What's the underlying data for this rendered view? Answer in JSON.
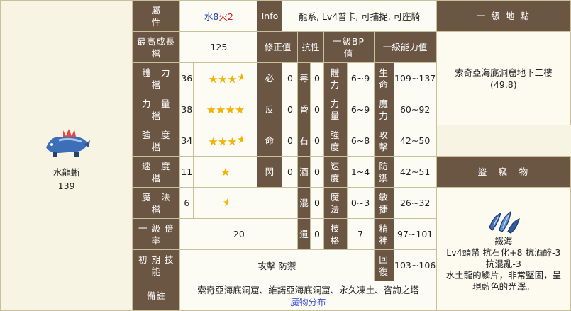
{
  "monster": {
    "name": "水龍蜥",
    "number": "139"
  },
  "attr": {
    "label": "屬\n性",
    "water": "水8",
    "fire": "火2"
  },
  "info": {
    "label": "Info",
    "value": "龍系, Lv4普卡, 可捕捉, 可座騎"
  },
  "growth": {
    "label": "最高成長\n檔",
    "value": "125"
  },
  "headers": {
    "modifier": "修正值",
    "resist": "抗性",
    "bp": "一級BP\n值",
    "ability": "一級能力值",
    "location": "一 級 地 點",
    "steal": "盜　竊　物"
  },
  "stats": [
    {
      "label": "體　力\n檔",
      "value": "36",
      "stars": 3.5,
      "mod": "必",
      "mod_val": "0",
      "res": "毒",
      "res_val": "0",
      "bp": "體\n力",
      "bp_val": "6~9",
      "ab": "生\n命",
      "ab_val": "109~137"
    },
    {
      "label": "力　量\n檔",
      "value": "38",
      "stars": 4,
      "mod": "反",
      "mod_val": "0",
      "res": "昏",
      "res_val": "0",
      "bp": "力\n量",
      "bp_val": "6~9",
      "ab": "魔\n力",
      "ab_val": "60~92"
    },
    {
      "label": "強　度\n檔",
      "value": "34",
      "stars": 3.5,
      "mod": "命",
      "mod_val": "0",
      "res": "石",
      "res_val": "0",
      "bp": "強\n度",
      "bp_val": "6~8",
      "ab": "攻\n擊",
      "ab_val": "42~50"
    },
    {
      "label": "速　度\n檔",
      "value": "11",
      "stars": 1,
      "mod": "閃",
      "mod_val": "0",
      "res": "酒",
      "res_val": "0",
      "bp": "速\n度",
      "bp_val": "1~4",
      "ab": "防\n禦",
      "ab_val": "42~51"
    },
    {
      "label": "魔　法\n檔",
      "value": "6",
      "stars": 0.5,
      "res": "混",
      "res_val": "0",
      "bp": "魔\n法",
      "bp_val": "0~3",
      "ab": "敏\n捷",
      "ab_val": "26~32"
    }
  ],
  "level_mult": {
    "label": "一 級 倍\n率",
    "value": "20",
    "res": "遺",
    "res_val": "0",
    "bp": "技\n格",
    "bp_val": "7",
    "ab": "精\n神",
    "ab_val": "97~101"
  },
  "skills": {
    "label": "初 期 技\n能",
    "value": "攻擊 防禦",
    "ab": "回\n復",
    "ab_val": "103~106"
  },
  "notes": {
    "label": "備註",
    "value": "索奇亞海底洞窟、維諾亞海底洞窟、永久凍土、咨詢之塔",
    "link": "魔物分布"
  },
  "location": {
    "value": "索奇亞海底洞窟地下二樓\n(49.8)"
  },
  "steal_item": {
    "name": "鐵海",
    "stats": "Lv4頭帶 抗石化+8 抗酒醉-3\n抗混亂-3",
    "desc": "水土龍的鱗片，非常堅固，呈\n現藍色的光澤。"
  },
  "colors": {
    "header_bg": "#6b5543",
    "panel_bg": "#f7f4e4",
    "water": "#2244aa",
    "fire": "#d01818",
    "link": "#3a4fd0",
    "star": "#f2b400"
  }
}
